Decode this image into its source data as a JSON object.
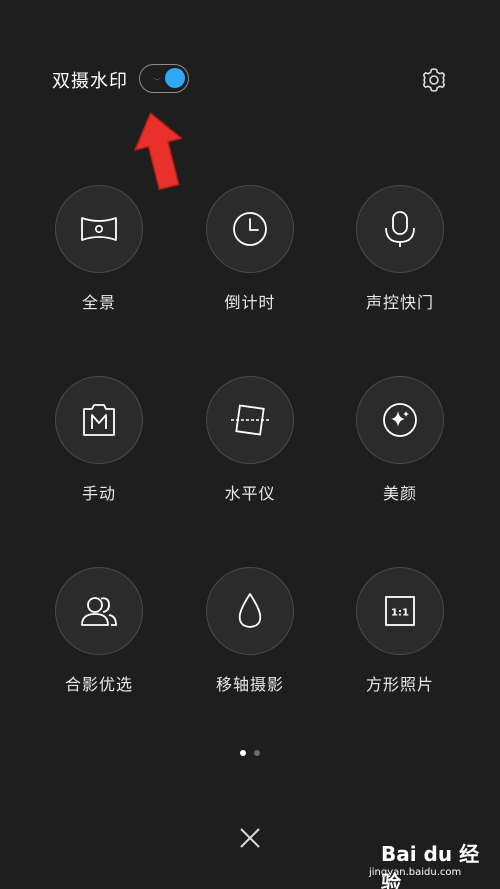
{
  "header": {
    "watermark_toggle_label": "双摄水印",
    "watermark_toggle_state": true,
    "settings_icon": "gear-icon"
  },
  "annotation": {
    "arrow_icon": "red-arrow-up-icon"
  },
  "modes": [
    {
      "label": "全景",
      "icon": "panorama-icon"
    },
    {
      "label": "倒计时",
      "icon": "clock-icon"
    },
    {
      "label": "声控快门",
      "icon": "microphone-icon"
    },
    {
      "label": "手动",
      "icon": "manual-m-icon"
    },
    {
      "label": "水平仪",
      "icon": "level-icon"
    },
    {
      "label": "美颜",
      "icon": "beauty-sparkle-icon"
    },
    {
      "label": "合影优选",
      "icon": "group-people-icon"
    },
    {
      "label": "移轴摄影",
      "icon": "drop-icon"
    },
    {
      "label": "方形照片",
      "icon": "square-1-1-icon"
    }
  ],
  "square_icon_text": "1:1",
  "pagination": {
    "pages": 2,
    "current": 1
  },
  "footer": {
    "close_icon": "close-icon"
  },
  "watermark": {
    "brand": "Bai du 经验",
    "url": "jingyan.baidu.com"
  },
  "colors": {
    "background": "#1e1e1e",
    "accent": "#2ea8f7",
    "arrow": "#e8312a"
  }
}
